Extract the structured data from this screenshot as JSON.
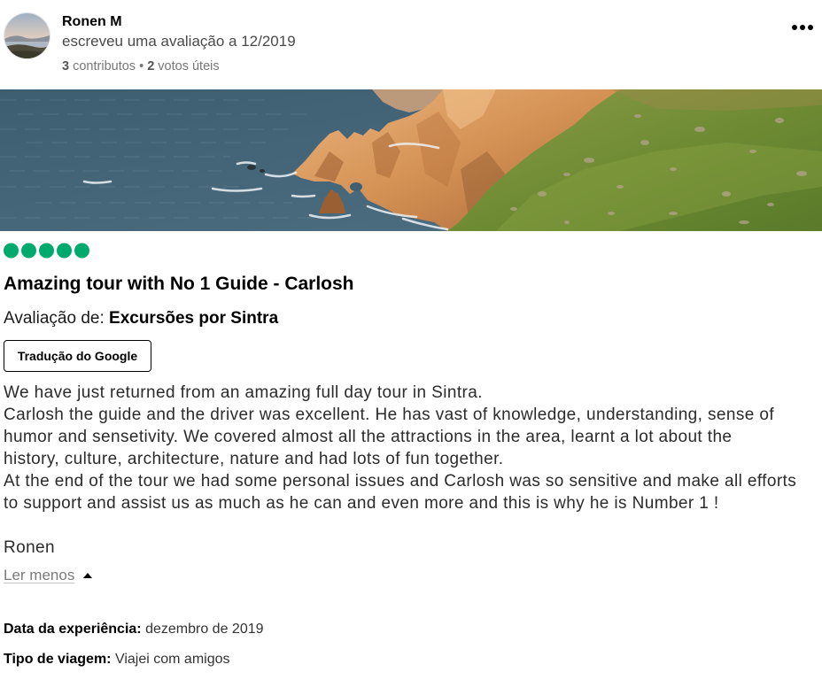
{
  "reviewer": {
    "name": "Ronen M",
    "action": "escreveu uma avaliação a 12/2019",
    "contributions_count": "3",
    "contributions_label": "contributos",
    "separator": "•",
    "helpful_count": "2",
    "helpful_label": "votos úteis"
  },
  "rating": {
    "value": 5,
    "max": 5
  },
  "review": {
    "title": "Amazing tour with No 1 Guide - Carlosh",
    "reviewed_label": "Avaliação de:",
    "reviewed_item": "Excursões por Sintra",
    "translate_button": "Tradução do Google",
    "body_lines": [
      "We have just returned from an amazing full day tour in Sintra.",
      "Carlosh the guide and the driver was excellent. He has vast of knowledge, understanding, sense of",
      "humor and sensetivity. We covered almost all the attractions in the area, learnt a lot about the",
      "history, culture, architecture, nature and had lots of fun together.",
      "At the end of the tour we had some personal issues and Carlosh was so sensitive and make all efforts",
      "to support and assist us as much as he can and even more and this is why he is Number 1 !"
    ],
    "signature": "Ronen",
    "toggle_label": "Ler menos"
  },
  "details": {
    "experience_date_label": "Data da experiência:",
    "experience_date": "dezembro de 2019",
    "trip_type_label": "Tipo de viagem:",
    "trip_type": "Viajei com amigos"
  },
  "icons": {
    "avatar": "user-avatar-photo",
    "more": "more-options-icon",
    "toggle": "caret-up-icon"
  },
  "colors": {
    "rating": "#00aa6c",
    "text": "#2b2b2b",
    "muted": "#767676"
  }
}
